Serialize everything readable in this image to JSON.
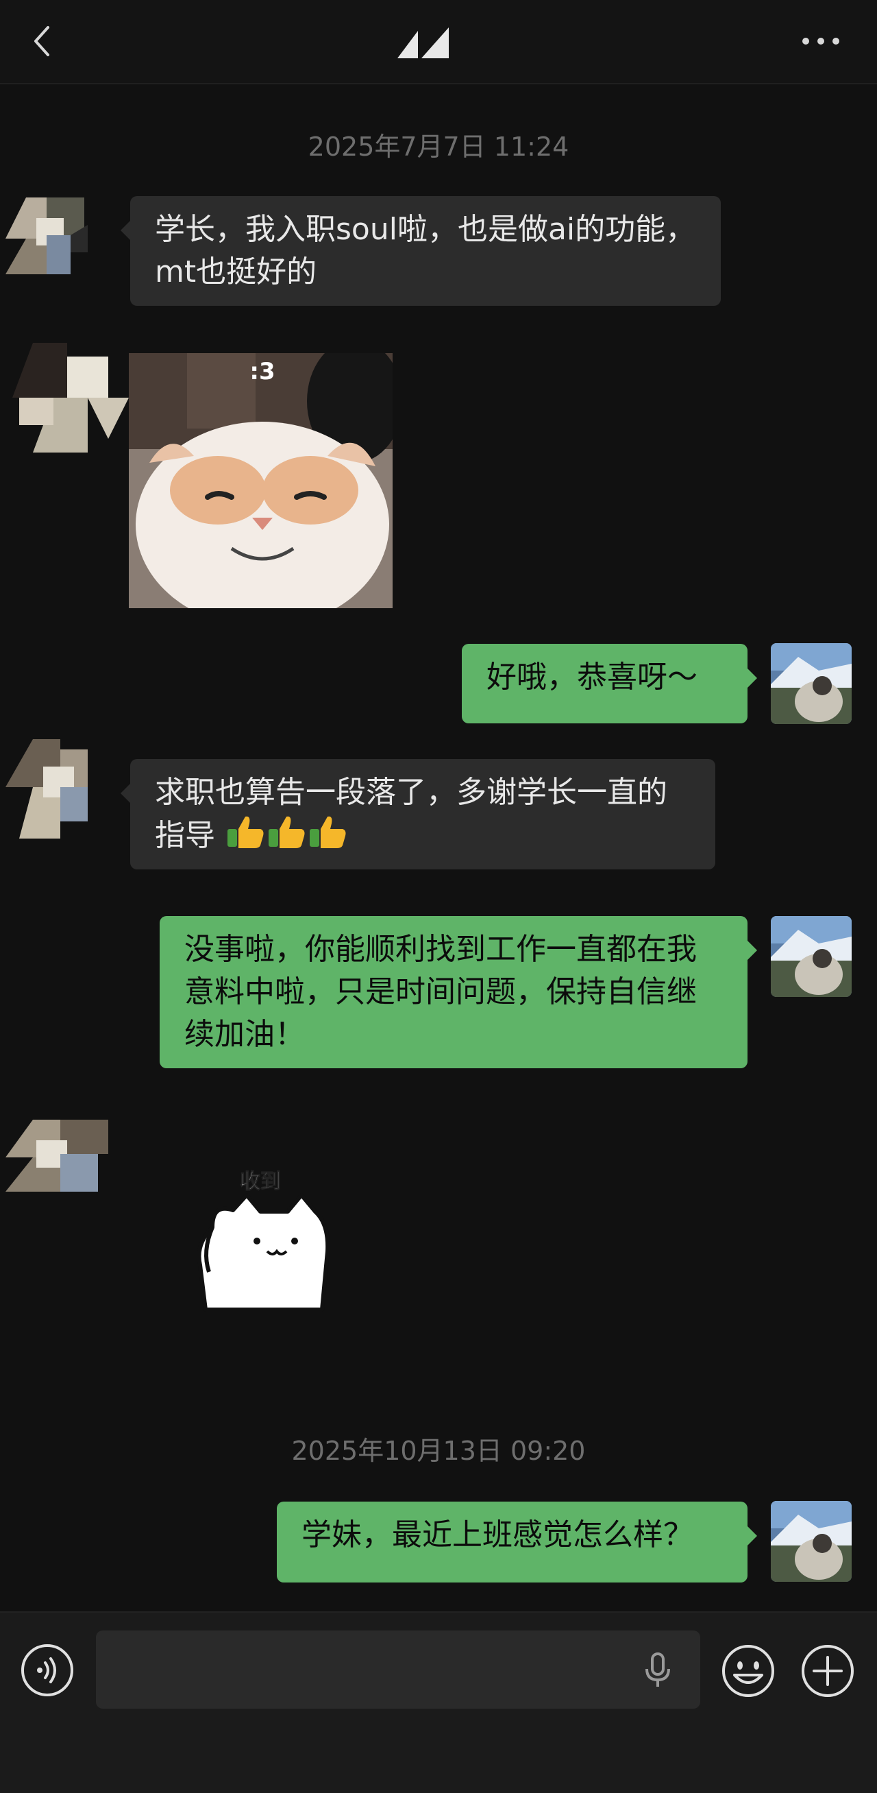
{
  "header": {
    "back_icon": "chevron-left-icon",
    "title_icon": "abstract-logo-icon",
    "more_icon": "more-dots-icon"
  },
  "messages": {
    "timestamp_1": "2025年7月7日 11:24",
    "msg_1": "学长，我入职soul啦，也是做ai的功能，mt也挺好的",
    "msg_2_sticker_text": ":3",
    "msg_3": "好哦，恭喜呀～",
    "msg_4": "求职也算告一段落了，多谢学长一直的指导",
    "msg_5": "没事啦，你能顺利找到工作一直都在我意料中啦，只是时间问题，保持自信继续加油！",
    "msg_6_sticker_text": "收到",
    "timestamp_2": "2025年10月13日 09:20",
    "msg_7": "学妹，最近上班感觉怎么样？"
  },
  "input_bar": {
    "voice_icon": "voice-icon",
    "mic_icon": "microphone-icon",
    "emoji_icon": "emoji-icon",
    "plus_icon": "plus-icon"
  },
  "colors": {
    "background": "#111111",
    "incoming_bubble": "#2c2c2c",
    "outgoing_bubble": "#5fb468",
    "timestamp": "#6e6e6e"
  }
}
